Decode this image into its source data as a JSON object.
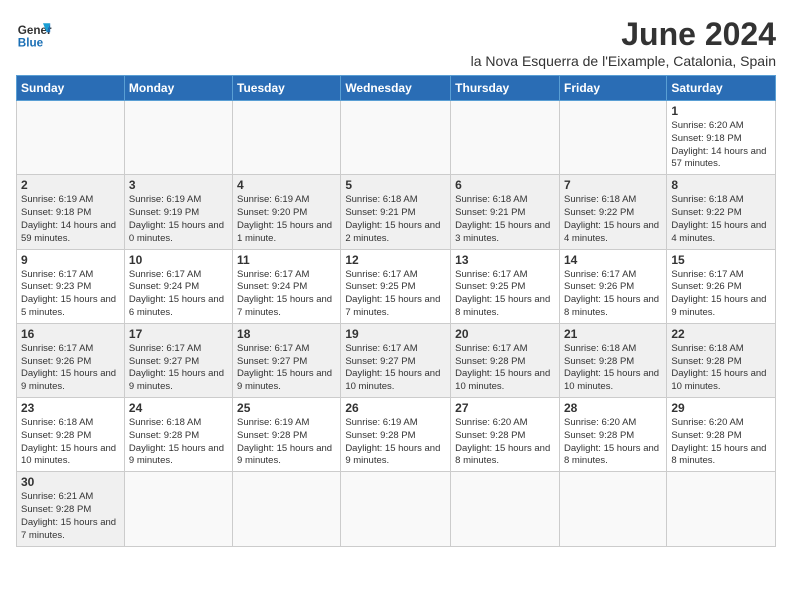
{
  "header": {
    "logo_line1": "General",
    "logo_line2": "Blue",
    "month_title": "June 2024",
    "location": "la Nova Esquerra de l'Eixample, Catalonia, Spain"
  },
  "weekdays": [
    "Sunday",
    "Monday",
    "Tuesday",
    "Wednesday",
    "Thursday",
    "Friday",
    "Saturday"
  ],
  "weeks": [
    [
      {
        "day": "",
        "info": ""
      },
      {
        "day": "",
        "info": ""
      },
      {
        "day": "",
        "info": ""
      },
      {
        "day": "",
        "info": ""
      },
      {
        "day": "",
        "info": ""
      },
      {
        "day": "",
        "info": ""
      },
      {
        "day": "1",
        "info": "Sunrise: 6:20 AM\nSunset: 9:18 PM\nDaylight: 14 hours\nand 57 minutes."
      }
    ],
    [
      {
        "day": "2",
        "info": "Sunrise: 6:19 AM\nSunset: 9:18 PM\nDaylight: 14 hours\nand 59 minutes."
      },
      {
        "day": "3",
        "info": "Sunrise: 6:19 AM\nSunset: 9:19 PM\nDaylight: 15 hours\nand 0 minutes."
      },
      {
        "day": "4",
        "info": "Sunrise: 6:19 AM\nSunset: 9:20 PM\nDaylight: 15 hours\nand 1 minute."
      },
      {
        "day": "5",
        "info": "Sunrise: 6:18 AM\nSunset: 9:21 PM\nDaylight: 15 hours\nand 2 minutes."
      },
      {
        "day": "6",
        "info": "Sunrise: 6:18 AM\nSunset: 9:21 PM\nDaylight: 15 hours\nand 3 minutes."
      },
      {
        "day": "7",
        "info": "Sunrise: 6:18 AM\nSunset: 9:22 PM\nDaylight: 15 hours\nand 4 minutes."
      },
      {
        "day": "8",
        "info": "Sunrise: 6:18 AM\nSunset: 9:22 PM\nDaylight: 15 hours\nand 4 minutes."
      }
    ],
    [
      {
        "day": "9",
        "info": "Sunrise: 6:17 AM\nSunset: 9:23 PM\nDaylight: 15 hours\nand 5 minutes."
      },
      {
        "day": "10",
        "info": "Sunrise: 6:17 AM\nSunset: 9:24 PM\nDaylight: 15 hours\nand 6 minutes."
      },
      {
        "day": "11",
        "info": "Sunrise: 6:17 AM\nSunset: 9:24 PM\nDaylight: 15 hours\nand 7 minutes."
      },
      {
        "day": "12",
        "info": "Sunrise: 6:17 AM\nSunset: 9:25 PM\nDaylight: 15 hours\nand 7 minutes."
      },
      {
        "day": "13",
        "info": "Sunrise: 6:17 AM\nSunset: 9:25 PM\nDaylight: 15 hours\nand 8 minutes."
      },
      {
        "day": "14",
        "info": "Sunrise: 6:17 AM\nSunset: 9:26 PM\nDaylight: 15 hours\nand 8 minutes."
      },
      {
        "day": "15",
        "info": "Sunrise: 6:17 AM\nSunset: 9:26 PM\nDaylight: 15 hours\nand 9 minutes."
      }
    ],
    [
      {
        "day": "16",
        "info": "Sunrise: 6:17 AM\nSunset: 9:26 PM\nDaylight: 15 hours\nand 9 minutes."
      },
      {
        "day": "17",
        "info": "Sunrise: 6:17 AM\nSunset: 9:27 PM\nDaylight: 15 hours\nand 9 minutes."
      },
      {
        "day": "18",
        "info": "Sunrise: 6:17 AM\nSunset: 9:27 PM\nDaylight: 15 hours\nand 9 minutes."
      },
      {
        "day": "19",
        "info": "Sunrise: 6:17 AM\nSunset: 9:27 PM\nDaylight: 15 hours\nand 10 minutes."
      },
      {
        "day": "20",
        "info": "Sunrise: 6:17 AM\nSunset: 9:28 PM\nDaylight: 15 hours\nand 10 minutes."
      },
      {
        "day": "21",
        "info": "Sunrise: 6:18 AM\nSunset: 9:28 PM\nDaylight: 15 hours\nand 10 minutes."
      },
      {
        "day": "22",
        "info": "Sunrise: 6:18 AM\nSunset: 9:28 PM\nDaylight: 15 hours\nand 10 minutes."
      }
    ],
    [
      {
        "day": "23",
        "info": "Sunrise: 6:18 AM\nSunset: 9:28 PM\nDaylight: 15 hours\nand 10 minutes."
      },
      {
        "day": "24",
        "info": "Sunrise: 6:18 AM\nSunset: 9:28 PM\nDaylight: 15 hours\nand 9 minutes."
      },
      {
        "day": "25",
        "info": "Sunrise: 6:19 AM\nSunset: 9:28 PM\nDaylight: 15 hours\nand 9 minutes."
      },
      {
        "day": "26",
        "info": "Sunrise: 6:19 AM\nSunset: 9:28 PM\nDaylight: 15 hours\nand 9 minutes."
      },
      {
        "day": "27",
        "info": "Sunrise: 6:20 AM\nSunset: 9:28 PM\nDaylight: 15 hours\nand 8 minutes."
      },
      {
        "day": "28",
        "info": "Sunrise: 6:20 AM\nSunset: 9:28 PM\nDaylight: 15 hours\nand 8 minutes."
      },
      {
        "day": "29",
        "info": "Sunrise: 6:20 AM\nSunset: 9:28 PM\nDaylight: 15 hours\nand 8 minutes."
      }
    ],
    [
      {
        "day": "30",
        "info": "Sunrise: 6:21 AM\nSunset: 9:28 PM\nDaylight: 15 hours\nand 7 minutes."
      },
      {
        "day": "",
        "info": ""
      },
      {
        "day": "",
        "info": ""
      },
      {
        "day": "",
        "info": ""
      },
      {
        "day": "",
        "info": ""
      },
      {
        "day": "",
        "info": ""
      },
      {
        "day": "",
        "info": ""
      }
    ]
  ]
}
